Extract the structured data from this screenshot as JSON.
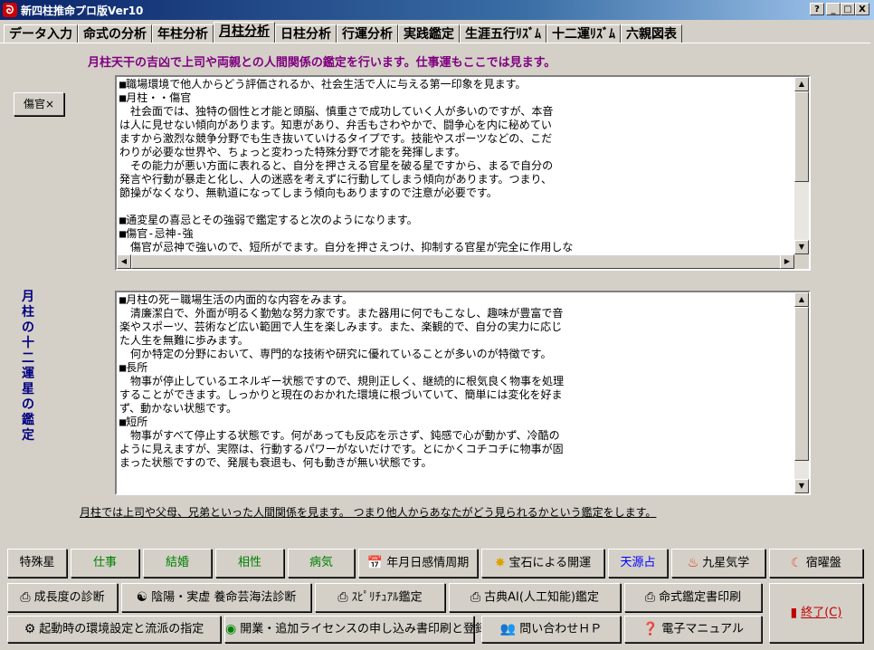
{
  "window": {
    "title": "新四柱推命プロ版Ver10",
    "controls": [
      "?",
      "_",
      "□",
      "X"
    ]
  },
  "tabs": [
    {
      "label": "データ入力"
    },
    {
      "label": "命式の分析"
    },
    {
      "label": "年柱分析"
    },
    {
      "label": "月柱分析",
      "active": true
    },
    {
      "label": "日柱分析"
    },
    {
      "label": "行運分析"
    },
    {
      "label": "実践鑑定"
    },
    {
      "label": "生涯五行ﾘｽﾞﾑ"
    },
    {
      "label": "十二運ﾘｽﾞﾑ"
    },
    {
      "label": "六親図表"
    }
  ],
  "main": {
    "heading": "月柱天干の吉凶で上司や両親との人間関係の鑑定を行います。仕事運もここでは見ます。",
    "side_button": "傷官×",
    "vertical_label": "月柱の十二運星の鑑定",
    "text1": "■職場環境で他人からどう評価されるか、社会生活で人に与える第一印象を見ます。\n■月柱・・傷官\n　社会面では、独特の個性と才能と頭脳、慎重さで成功していく人が多いのですが、本音\nは人に見せない傾向があります。知恵があり、弁舌もさわやかで、闘争心を内に秘めてい\nますから激烈な競争分野でも生き抜いていけるタイプです。技能やスポーツなどの、こだ\nわりが必要な世界や、ちょっと変わった特殊分野で才能を発揮します。\n　その能力が悪い方面に表れると、自分を押さえる官星を破る星ですから、まるで自分の\n発言や行動が暴走と化し、人の迷惑を考えずに行動してしまう傾向があります。つまり、\n節操がなくなり、無軌道になってしまう傾向もありますので注意が必要です。\n\n■通変星の喜忌とその強弱で鑑定すると次のようになります。\n■傷官-忌神-強\n　傷官が忌神で強いので、短所がでます。自分を押さえつけ、抑制する官星が完全に作用しな",
    "text2": "■月柱の死－職場生活の内面的な内容をみます。\n　清廉潔白で、外面が明るく勤勉な努力家です。また器用に何でもこなし、趣味が豊富で音\n楽やスポーツ、芸術など広い範囲で人生を楽しみます。また、楽観的で、自分の実力に応じ\nた人生を無難に歩みます。\n　何か特定の分野において、専門的な技術や研究に優れていることが多いのが特徴です。\n■長所\n　物事が停止しているエネルギー状態ですので、規則正しく、継続的に根気良く物事を処理\nすることができます。しっかりと現在のおかれた環境に根づいていて、簡単には変化を好ま\nず、動かない状態です。\n■短所\n　物事がすべて停止する状態です。何があっても反応を示さず、鈍感で心が動かず、冷酷の\nように見えますが、実際は、行動するパワーがないだけです。とにかくコチコチに物事が固\nまった状態ですので、発展も衰退も、何も動きが無い状態です。",
    "footnote": "月柱では上司や父母、兄弟といった人間関係を見ます。 つまり他人からあなたがどう見られるかという鑑定をします。"
  },
  "bottom": {
    "row1": [
      {
        "label": "特殊星",
        "color": "black"
      },
      {
        "label": "仕事",
        "color": "green"
      },
      {
        "label": "結婚",
        "color": "green"
      },
      {
        "label": "相性",
        "color": "green"
      },
      {
        "label": "病気",
        "color": "green"
      },
      {
        "label": "年月日感情周期",
        "icon": "calendar-icon"
      },
      {
        "label": "宝石による開運",
        "icon": "sun-icon"
      },
      {
        "label": "天源占",
        "color": "blue"
      },
      {
        "label": "九星気学",
        "icon": "fire-icon"
      },
      {
        "label": "宿曜盤",
        "icon": "moon-icon"
      }
    ],
    "row2": [
      {
        "label": "成長度の診断",
        "icon": "printer-icon"
      },
      {
        "label": "陰陽・実虚  養命芸海法診断",
        "icon": "yinyang-icon"
      },
      {
        "label": "ｽﾋﾟﾘﾁｭｱﾙ鑑定",
        "icon": "printer-icon"
      },
      {
        "label": "古典AI(人工知能)鑑定",
        "icon": "printer-icon"
      },
      {
        "label": "命式鑑定書印刷",
        "icon": "printer-icon"
      }
    ],
    "row3": [
      {
        "label": "起動時の環境設定と流派の指定",
        "icon": "settings-icon"
      },
      {
        "label": "開業・追加ライセンスの申し込み書印刷と登録",
        "icon": "globe-icon"
      },
      {
        "label": "問い合わせＨＰ",
        "icon": "people-icon"
      },
      {
        "label": "電子マニュアル",
        "icon": "help-icon"
      }
    ],
    "exit": {
      "label": "終了(C)",
      "icon": "exit-icon"
    }
  }
}
